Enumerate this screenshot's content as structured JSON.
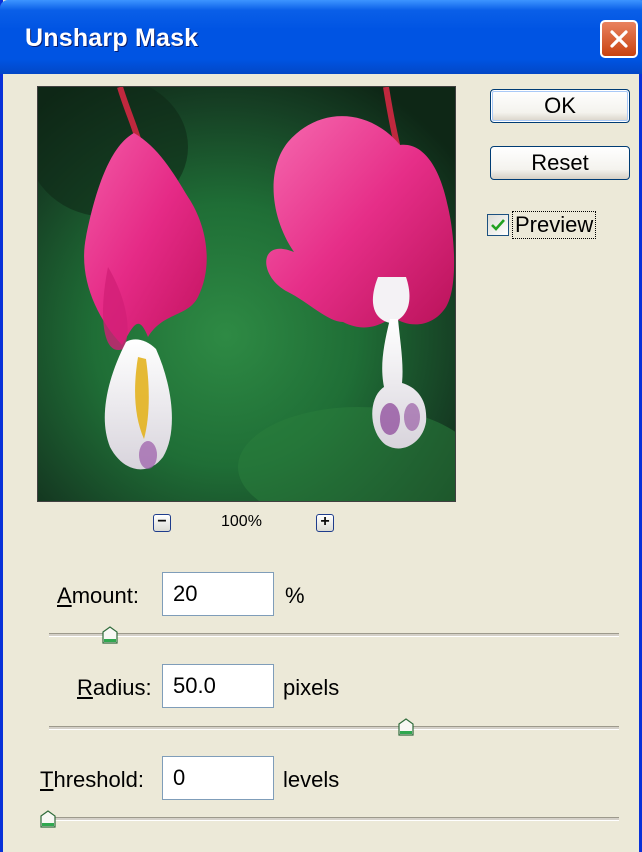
{
  "window": {
    "title": "Unsharp Mask"
  },
  "buttons": {
    "ok": "OK",
    "reset": "Reset"
  },
  "preview_checkbox": {
    "label": "Preview",
    "checked": true
  },
  "zoom": {
    "level": "100%",
    "minus_icon": "minus-icon",
    "plus_icon": "plus-icon"
  },
  "controls": {
    "amount": {
      "label_underline": "A",
      "label_rest": "mount:",
      "value": "20",
      "unit": "%",
      "slider_level_pct": 11
    },
    "radius": {
      "label_underline": "R",
      "label_rest": "adius:",
      "value": "50.0",
      "unit": "pixels",
      "slider_level_pct": 63
    },
    "threshold": {
      "label_underline": "T",
      "label_rest": "hreshold:",
      "value": "0",
      "unit": "levels",
      "slider_level_pct": 0
    }
  },
  "colors": {
    "title_bar": "#0054e3",
    "dialog_bg": "#ece9d8",
    "close_button": "#d2512a",
    "slider_thumb_accent": "#2fa84f"
  }
}
